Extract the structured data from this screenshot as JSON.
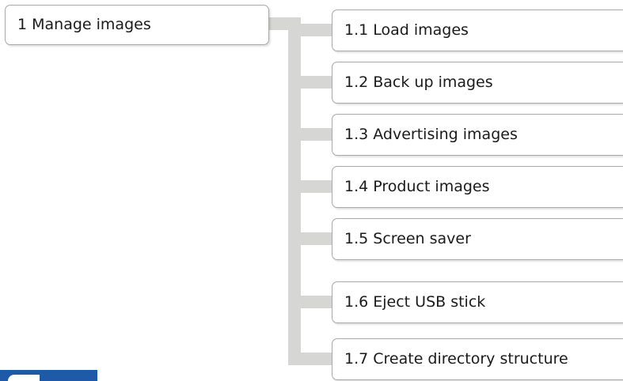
{
  "diagram": {
    "root": {
      "label": "1 Manage images"
    },
    "children": [
      {
        "label": "1.1 Load images"
      },
      {
        "label": "1.2 Back up images"
      },
      {
        "label": "1.3 Advertising images"
      },
      {
        "label": "1.4 Product images"
      },
      {
        "label": "1.5 Screen saver"
      },
      {
        "label": "1.6 Eject USB stick"
      },
      {
        "label": "1.7  Create directory structure"
      }
    ]
  },
  "colors": {
    "connector": "#d6d6d4",
    "node_border": "#a8a8a8",
    "logo": "#1e5aa8"
  }
}
